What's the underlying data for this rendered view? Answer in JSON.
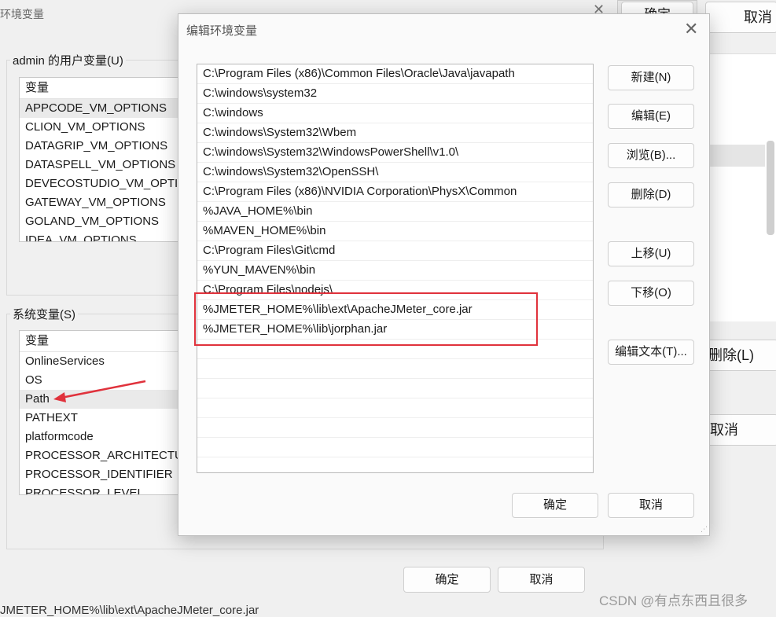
{
  "background_window": {
    "title": "环境变量",
    "user_vars_label": "admin 的用户变量(U)",
    "user_vars_header": "变量",
    "user_vars": [
      "APPCODE_VM_OPTIONS",
      "CLION_VM_OPTIONS",
      "DATAGRIP_VM_OPTIONS",
      "DATASPELL_VM_OPTIONS",
      "DEVECOSTUDIO_VM_OPTI...",
      "GATEWAY_VM_OPTIONS",
      "GOLAND_VM_OPTIONS",
      "IDEA_VM_OPTIONS"
    ],
    "system_vars_label": "系统变量(S)",
    "system_vars_header": "变量",
    "system_vars": [
      "OnlineServices",
      "OS",
      "Path",
      "PATHEXT",
      "platformcode",
      "PROCESSOR_ARCHITECTUR",
      "PROCESSOR_IDENTIFIER",
      "PROCESSOR_LEVEL"
    ],
    "ok_label": "确定",
    "cancel_label": "取消",
    "status_text": "JMETER_HOME%\\lib\\ext\\ApacheJMeter_core.jar"
  },
  "right_remnant": {
    "top_ok": "确定",
    "top_cancel": "取消",
    "delete_label": "删除(L)",
    "cancel_label": "取消"
  },
  "dialog": {
    "title": "编辑环境变量",
    "paths": [
      "C:\\Program Files (x86)\\Common Files\\Oracle\\Java\\javapath",
      "C:\\windows\\system32",
      "C:\\windows",
      "C:\\windows\\System32\\Wbem",
      "C:\\windows\\System32\\WindowsPowerShell\\v1.0\\",
      "C:\\windows\\System32\\OpenSSH\\",
      "C:\\Program Files (x86)\\NVIDIA Corporation\\PhysX\\Common",
      "%JAVA_HOME%\\bin",
      "%MAVEN_HOME%\\bin",
      "C:\\Program Files\\Git\\cmd",
      "%YUN_MAVEN%\\bin",
      "C:\\Program Files\\nodejs\\",
      "%JMETER_HOME%\\lib\\ext\\ApacheJMeter_core.jar",
      "%JMETER_HOME%\\lib\\jorphan.jar",
      "",
      "",
      "",
      "",
      "",
      "",
      "",
      ""
    ],
    "buttons": {
      "new": "新建(N)",
      "edit": "编辑(E)",
      "browse": "浏览(B)...",
      "delete": "删除(D)",
      "move_up": "上移(U)",
      "move_down": "下移(O)",
      "edit_text": "编辑文本(T)...",
      "ok": "确定",
      "cancel": "取消"
    },
    "highlight_color": "#e0323c"
  },
  "annotation": {
    "arrow_color": "#e0323c"
  },
  "watermark": "CSDN @有点东西且很多"
}
